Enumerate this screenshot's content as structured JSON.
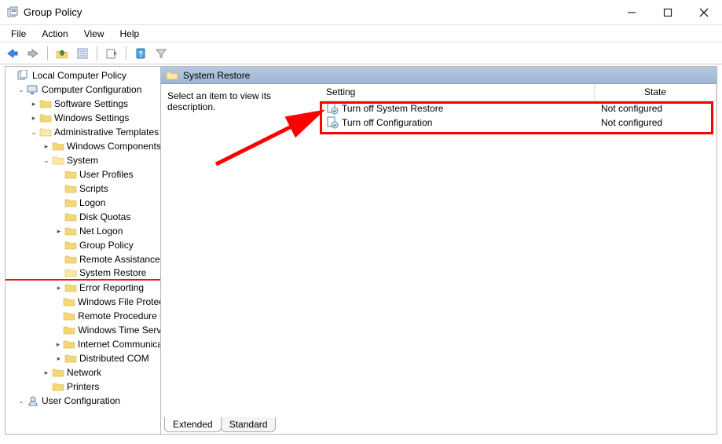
{
  "title": "Group Policy",
  "menus": [
    "File",
    "Action",
    "View",
    "Help"
  ],
  "toolbar": {
    "back": "back-icon",
    "forward": "forward-icon",
    "up": "up-icon",
    "props": "properties-icon",
    "refresh": "refresh-icon",
    "export": "export-icon",
    "help": "help-icon",
    "filter": "filter-icon"
  },
  "tree": {
    "root": "Local Computer Policy",
    "cc": "Computer Configuration",
    "cc_children": [
      "Software Settings",
      "Windows Settings"
    ],
    "at": "Administrative Templates",
    "at_children_top": [
      "Windows Components"
    ],
    "system": "System",
    "system_children": [
      "User Profiles",
      "Scripts",
      "Logon",
      "Disk Quotas",
      "Net Logon",
      "Group Policy",
      "Remote Assistance",
      "System Restore",
      "Error Reporting",
      "Windows File Protection",
      "Remote Procedure Call",
      "Windows Time Service",
      "Internet Communication",
      "Distributed COM"
    ],
    "at_children_bottom": [
      "Network",
      "Printers"
    ],
    "uc": "User Configuration"
  },
  "detail": {
    "headerTitle": "System Restore",
    "description": "Select an item to view its description.",
    "cols": {
      "setting": "Setting",
      "state": "State"
    },
    "rows": [
      {
        "name": "Turn off System Restore",
        "state": "Not configured"
      },
      {
        "name": "Turn off Configuration",
        "state": "Not configured"
      }
    ],
    "tabs": {
      "extended": "Extended",
      "standard": "Standard"
    }
  }
}
